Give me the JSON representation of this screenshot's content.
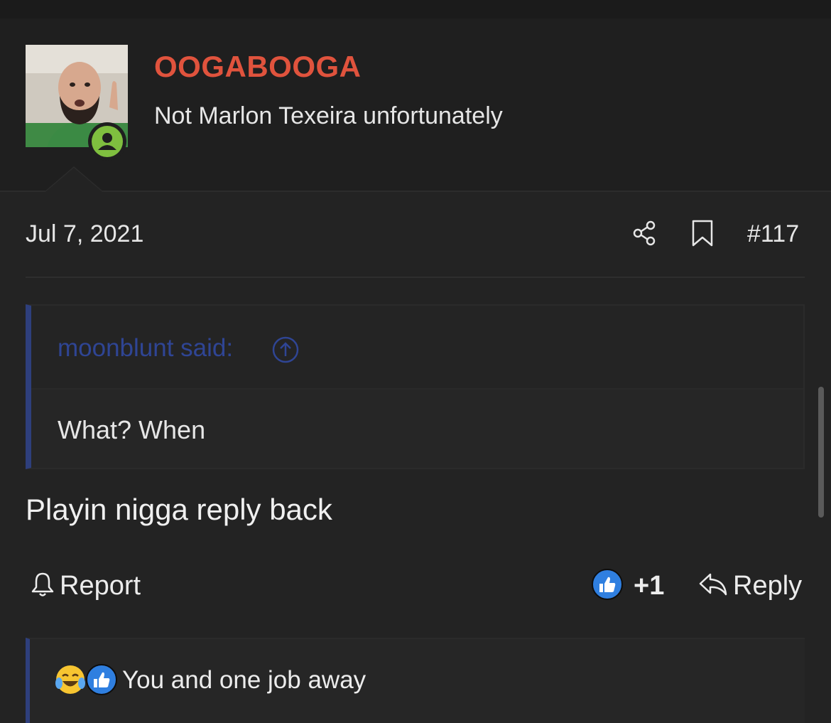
{
  "colors": {
    "background": "#232323",
    "username": "#e0533d",
    "quote_accent": "#2e3f7c",
    "quote_author": "#2f4594",
    "online": "#7fbf3f",
    "like_blue": "#2f7fe0"
  },
  "user": {
    "name": "OOGABOOGA",
    "title": "Not Marlon Texeira unfortunately",
    "avatar_icon": "user-avatar-photo",
    "status_icon": "online-user-icon"
  },
  "post": {
    "date": "Jul 7, 2021",
    "number": "#117",
    "share_icon": "share-icon",
    "bookmark_icon": "bookmark-icon"
  },
  "quote": {
    "author": "moonblunt said:",
    "jump_icon": "arrow-up-circle-icon",
    "body": "What? When"
  },
  "message": "Playin nigga reply back",
  "actions": {
    "report_label": "Report",
    "like_count": "+1",
    "reply_label": "Reply"
  },
  "reactions": {
    "icons": [
      "laughing-crying-emoji-icon",
      "thumbs-up-icon"
    ],
    "text": "You and one job away"
  }
}
